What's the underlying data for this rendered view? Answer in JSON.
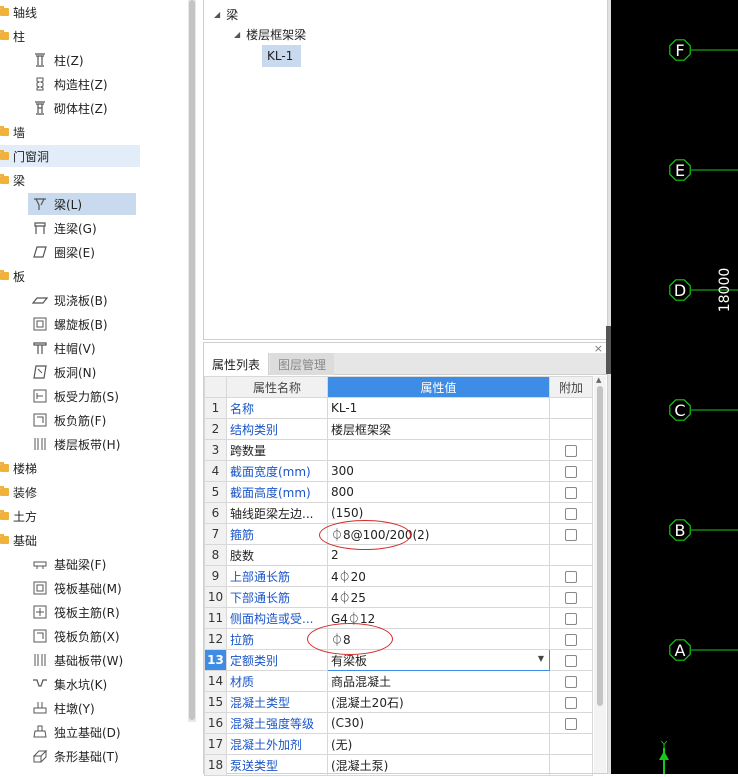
{
  "nav": {
    "categories": {
      "axis": "轴线",
      "column": "柱",
      "wall": "墙",
      "opening": "门窗洞",
      "beam": "梁",
      "slab": "板",
      "stair": "楼梯",
      "decoration": "装修",
      "earthwork": "土方",
      "foundation": "基础"
    },
    "items": {
      "col_z": "柱(Z)",
      "gzz": "构造柱(Z)",
      "qtz": "砌体柱(Z)",
      "beam_l": "梁(L)",
      "link_g": "连梁(G)",
      "ring_e": "圈梁(E)",
      "xjb": "现浇板(B)",
      "lxb": "螺旋板(B)",
      "zm": "柱帽(V)",
      "bd": "板洞(N)",
      "bsl": "板受力筋(S)",
      "bfj": "板负筋(F)",
      "lcbd": "楼层板带(H)",
      "jcl": "基础梁(F)",
      "fbjc": "筏板基础(M)",
      "fbzj": "筏板主筋(R)",
      "fbfj": "筏板负筋(X)",
      "jcbd": "基础板带(W)",
      "jsk": "集水坑(K)",
      "zd": "柱墩(Y)",
      "dljc": "独立基础(D)",
      "txjc": "条形基础(T)"
    }
  },
  "tree": {
    "root": "梁",
    "child": "楼层框架梁",
    "leaf": "KL-1"
  },
  "props": {
    "close": "×",
    "tabs": [
      "属性列表",
      "图层管理"
    ],
    "headers": {
      "name": "属性名称",
      "value": "属性值",
      "extra": "附加"
    },
    "rows": [
      {
        "n": "1",
        "name": "名称",
        "value": "KL-1"
      },
      {
        "n": "2",
        "name": "结构类别",
        "value": "楼层框架梁"
      },
      {
        "n": "3",
        "name": "跨数量",
        "value": ""
      },
      {
        "n": "4",
        "name": "截面宽度(mm)",
        "value": "300"
      },
      {
        "n": "5",
        "name": "截面高度(mm)",
        "value": "800"
      },
      {
        "n": "6",
        "name": "轴线距梁左边...",
        "value": "(150)"
      },
      {
        "n": "7",
        "name": "箍筋",
        "value": "⏀8@100/200(2)"
      },
      {
        "n": "8",
        "name": "肢数",
        "value": "2"
      },
      {
        "n": "9",
        "name": "上部通长筋",
        "value": "4⏀20"
      },
      {
        "n": "10",
        "name": "下部通长筋",
        "value": "4⏀25"
      },
      {
        "n": "11",
        "name": "侧面构造或受...",
        "value": "G4⏀12"
      },
      {
        "n": "12",
        "name": "拉筋",
        "value": "⏀8"
      },
      {
        "n": "13",
        "name": "定额类别",
        "value": "有梁板"
      },
      {
        "n": "14",
        "name": "材质",
        "value": "商品混凝土"
      },
      {
        "n": "15",
        "name": "混凝土类型",
        "value": "(混凝土20石)"
      },
      {
        "n": "16",
        "name": "混凝土强度等级",
        "value": "(C30)"
      },
      {
        "n": "17",
        "name": "混凝土外加剂",
        "value": "(无)"
      },
      {
        "n": "18",
        "name": "泵送类型",
        "value": "(混凝土泵)"
      }
    ]
  },
  "canvas": {
    "axes": [
      "F",
      "E",
      "D",
      "C",
      "B",
      "A"
    ],
    "dimension": "18000",
    "ucs": "Y"
  },
  "colors": {
    "accent": "#3d8de6",
    "selection": "#c9d9ee",
    "cad_green": "#18c818",
    "mark_red": "#d42828"
  }
}
